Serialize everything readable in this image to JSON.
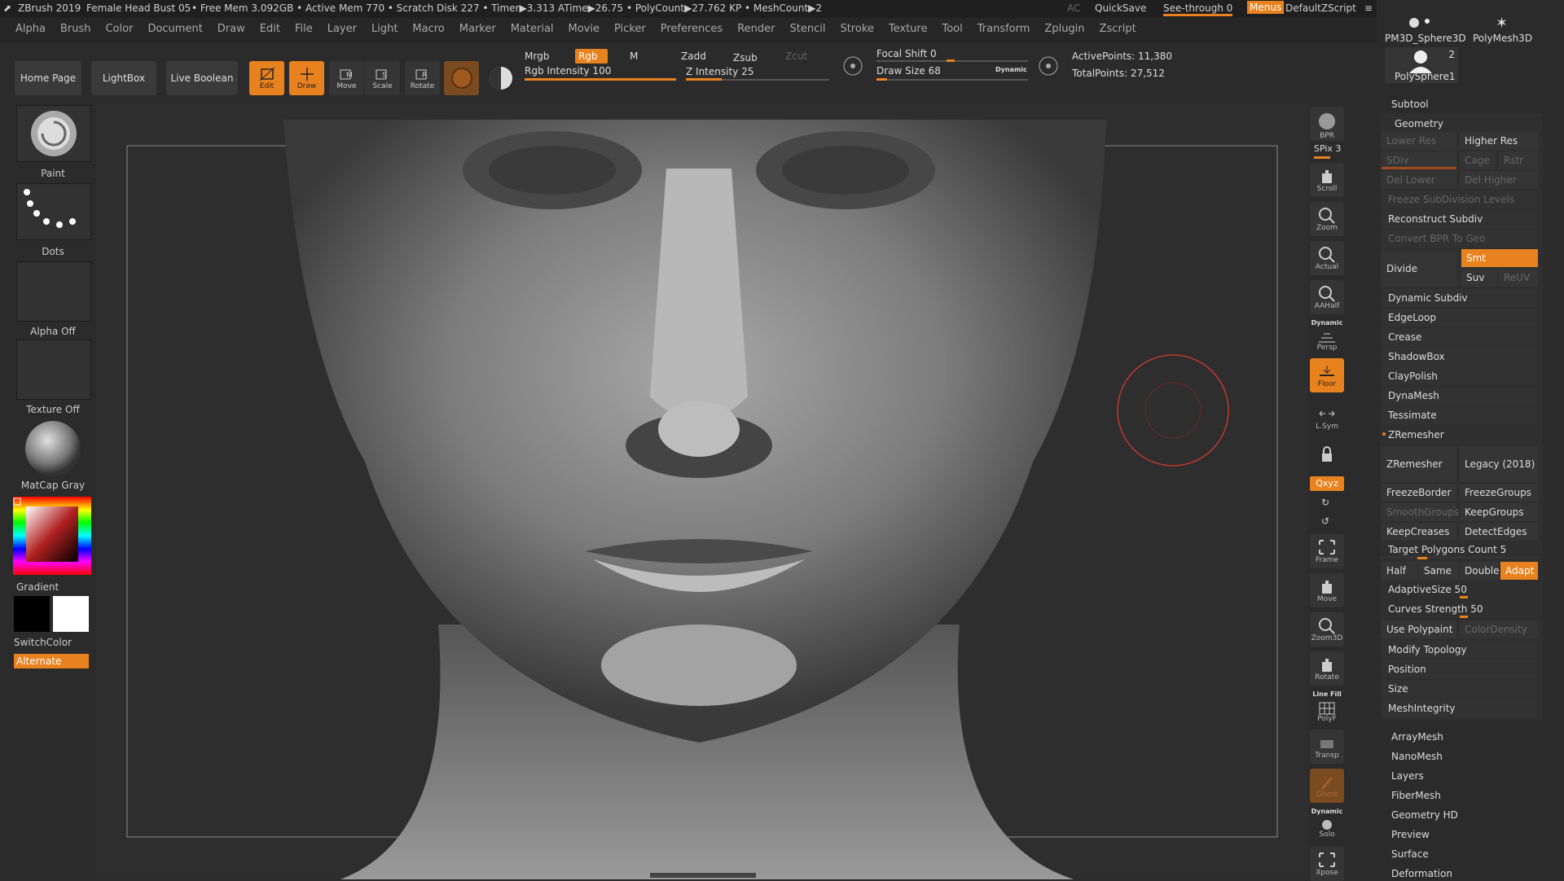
{
  "title_bar": {
    "app": "ZBrush 2019",
    "document": "Female Head Bust 05",
    "stats": "• Free Mem 3.092GB • Active Mem 770 • Scratch Disk 227 • Timer▶3.313 ATime▶26.75 • PolyCount▶27.762 KP • MeshCount▶2",
    "ac": "AC",
    "quicksave": "QuickSave",
    "see_through": "See-through  0",
    "menus": "Menus",
    "script": "DefaultZScript"
  },
  "menu_items": [
    "Alpha",
    "Brush",
    "Color",
    "Document",
    "Draw",
    "Edit",
    "File",
    "Layer",
    "Light",
    "Macro",
    "Marker",
    "Material",
    "Movie",
    "Picker",
    "Preferences",
    "Render",
    "Stencil",
    "Stroke",
    "Texture",
    "Tool",
    "Transform",
    "Zplugin",
    "Zscript"
  ],
  "shelf": {
    "home_page": "Home Page",
    "lightbox": "LightBox",
    "live_boolean": "Live Boolean",
    "edit": "Edit",
    "draw": "Draw",
    "move": "Move",
    "scale": "Scale",
    "rotate": "Rotate",
    "mrgb": "Mrgb",
    "rgb": "Rgb",
    "m": "M",
    "rgb_intensity": "Rgb Intensity 100",
    "rgb_intensity_value": 100,
    "zadd": "Zadd",
    "zsub": "Zsub",
    "zcut": "Zcut",
    "z_intensity": "Z Intensity 25",
    "z_intensity_value": 25,
    "focal_shift": "Focal Shift 0",
    "focal_shift_value": 0,
    "draw_size": "Draw Size 68",
    "draw_size_value": 68,
    "dynamic": "Dynamic",
    "active_points": "ActivePoints: 11,380",
    "total_points": "TotalPoints: 27,512"
  },
  "left_tray": {
    "brush": "Paint",
    "stroke": "Dots",
    "alpha": "Alpha Off",
    "texture": "Texture Off",
    "material": "MatCap Gray",
    "gradient": "Gradient",
    "switch_color": "SwitchColor",
    "alternate": "Alternate"
  },
  "nav_buttons": [
    "BPR",
    "Scroll",
    "Zoom",
    "Actual",
    "AAHalf",
    "Persp",
    "Floor",
    "L.Sym",
    "Lock",
    "Frame",
    "Move",
    "Zoom3D",
    "Rotate",
    "PolyF",
    "Transp",
    "Ghost",
    "Solo",
    "Xpose"
  ],
  "nav_text": {
    "spix": "SPix 3",
    "xyz": "Qxyz",
    "dynamic_label": "Dynamic",
    "line_fill": "Line Fill"
  },
  "tool_thumbs": {
    "pm3d_sphere": "PM3D_Sphere3D",
    "polymesh3d": "PolyMesh3D",
    "polysphere": "PolySphere1",
    "count": "2"
  },
  "subtool_panel": {
    "subtool": "Subtool",
    "geometry": "Geometry",
    "lower_res": "Lower Res",
    "higher_res": "Higher Res",
    "sdiv": "SDiv",
    "cage": "Cage",
    "rstr": "Rstr",
    "del_lower": "Del Lower",
    "del_higher": "Del Higher",
    "freeze_subdiv": "Freeze SubDivision Levels",
    "reconstruct_subdiv": "Reconstruct Subdiv",
    "convert_bpr": "Convert BPR To Geo",
    "divide": "Divide",
    "smt": "Smt",
    "suv": "Suv",
    "reuv": "ReUV",
    "dynamic_subdiv": "Dynamic Subdiv",
    "edgeloop": "EdgeLoop",
    "crease": "Crease",
    "shadowbox": "ShadowBox",
    "claypolish": "ClayPolish",
    "dynamesh": "DynaMesh",
    "tessimate": "Tessimate",
    "zremesher_header": "ZRemesher",
    "zremesher_btn": "ZRemesher",
    "legacy": "Legacy (2018)",
    "freeze_border": "FreezeBorder",
    "freeze_groups": "FreezeGroups",
    "smooth_groups": "SmoothGroups",
    "keep_groups": "KeepGroups",
    "keep_creases": "KeepCreases",
    "detect_edges": "DetectEdges",
    "target_polys": "Target Polygons Count 5",
    "half": "Half",
    "same": "Same",
    "double": "Double",
    "adapt": "Adapt",
    "adaptive_size": "AdaptiveSize 50",
    "curves_strength": "Curves Strength 50",
    "use_polypaint": "Use Polypaint",
    "color_density": "ColorDensity",
    "modify_topology": "Modify Topology",
    "position": "Position",
    "size": "Size",
    "mesh_integrity": "MeshIntegrity",
    "array_mesh": "ArrayMesh",
    "nano_mesh": "NanoMesh",
    "layers": "Layers",
    "fiber_mesh": "FiberMesh",
    "geometry_hd": "Geometry HD",
    "preview": "Preview",
    "surface": "Surface",
    "deformation": "Deformation"
  },
  "colors": {
    "accent": "#e8821e",
    "brush_ring": "#c0392b"
  }
}
